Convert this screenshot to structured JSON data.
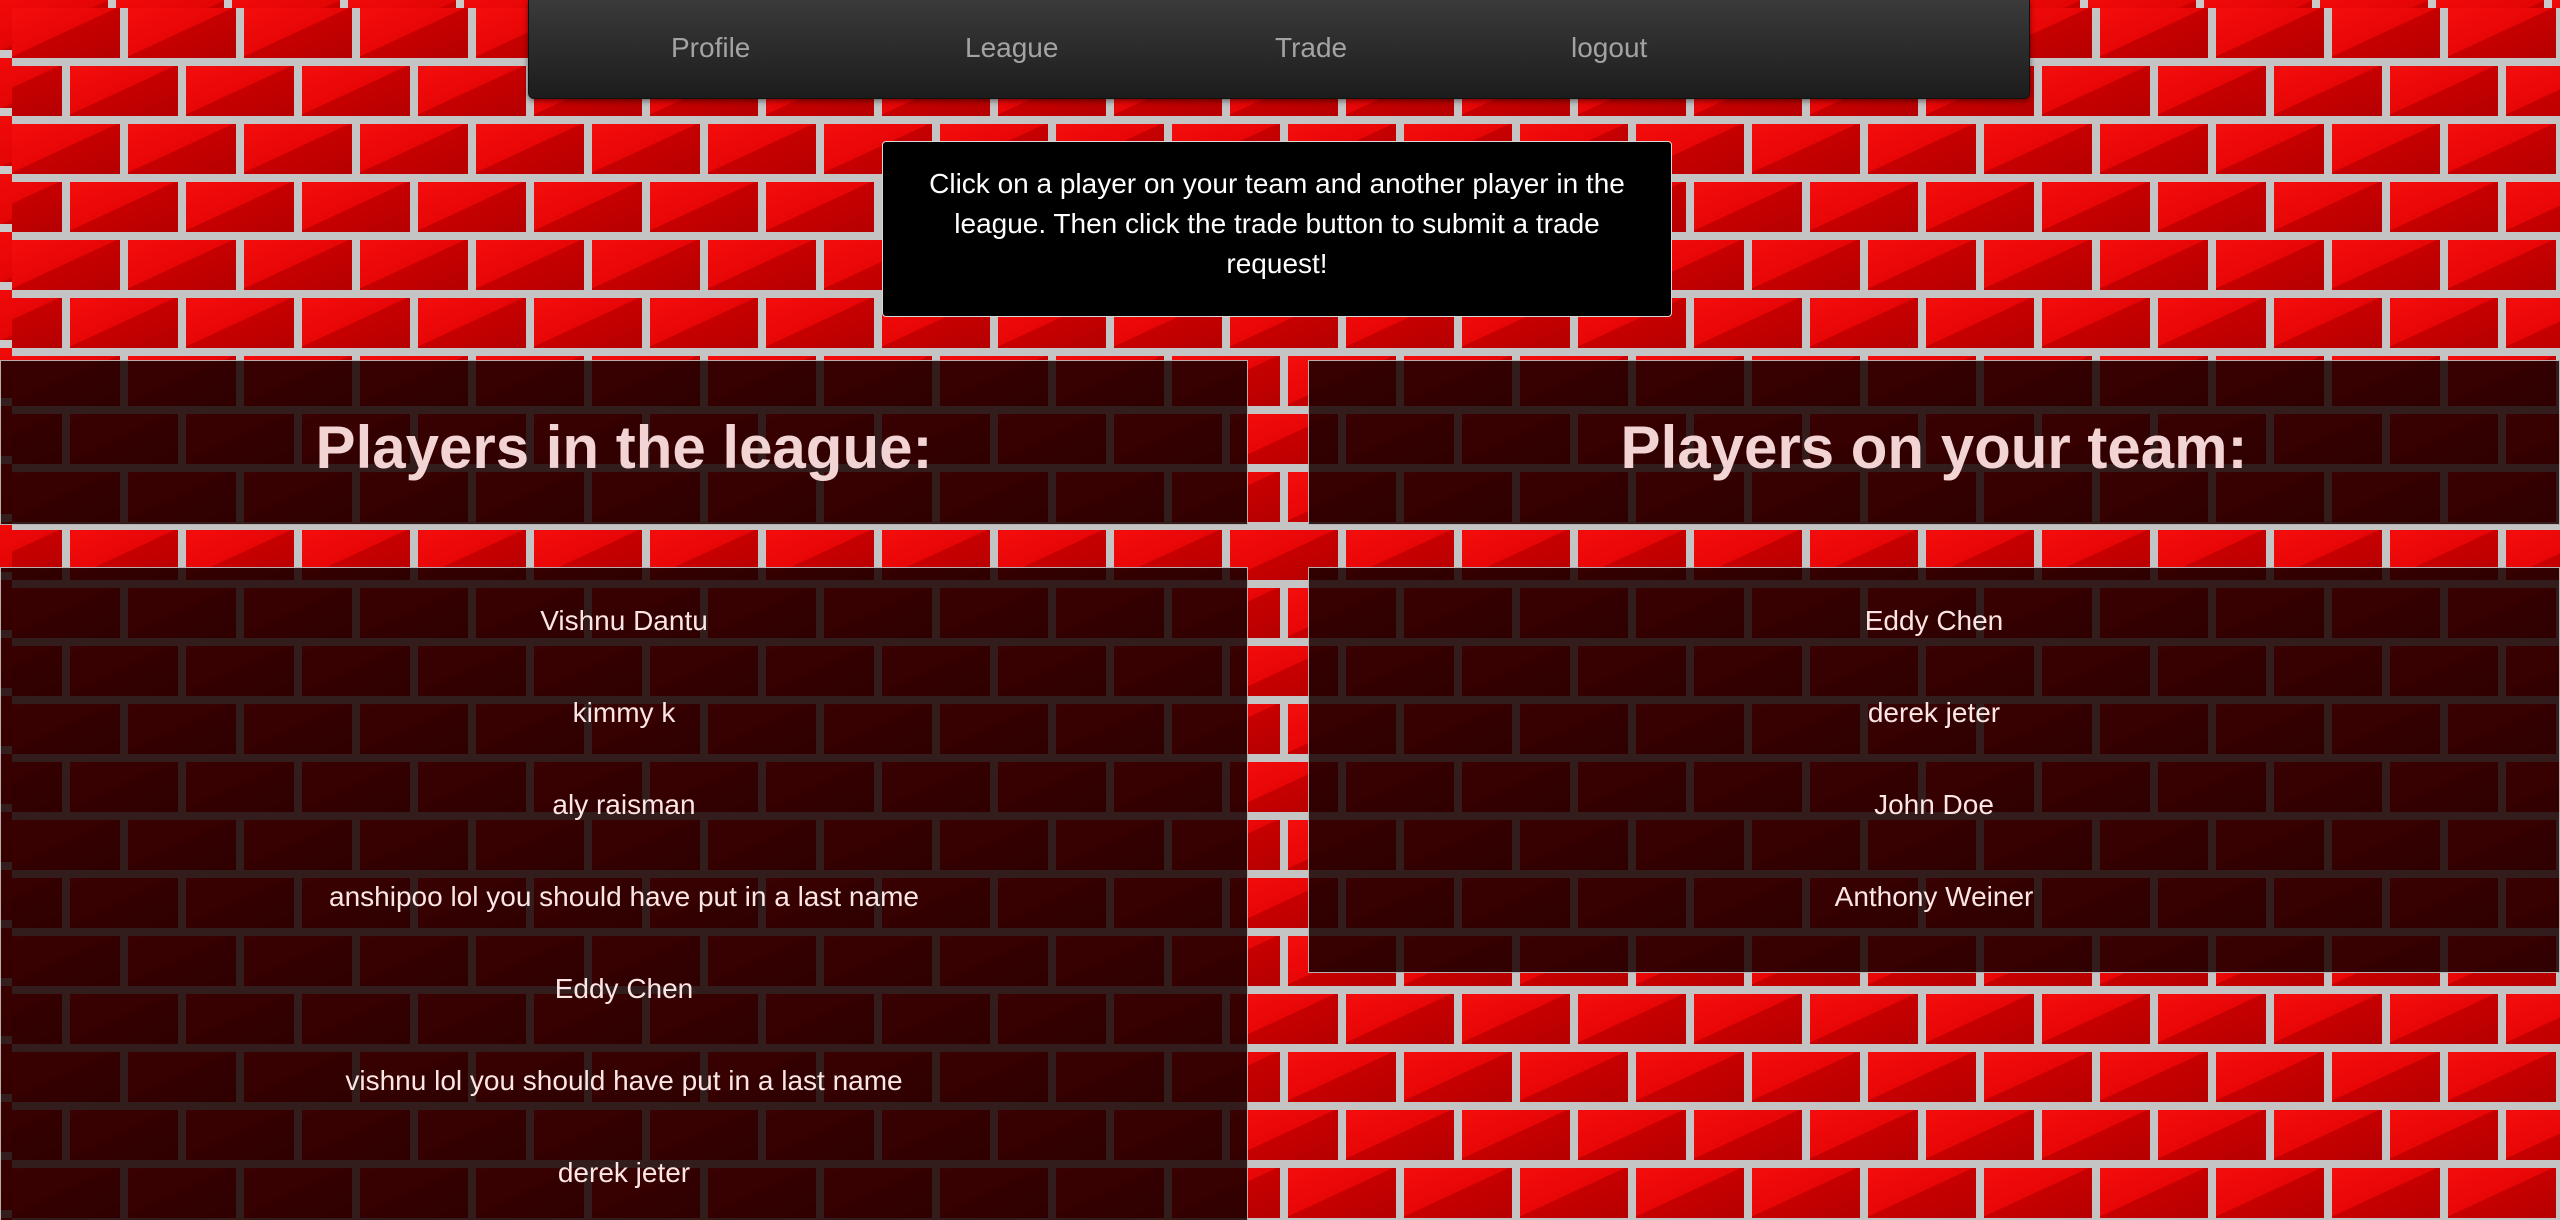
{
  "nav": {
    "profile": "Profile",
    "league": "League",
    "trade": "Trade",
    "logout": "logout"
  },
  "instructions": "Click on a player on your team and another player in the league. Then click the trade button to submit a trade request!",
  "league": {
    "title": "Players in the league:",
    "players": [
      "Vishnu Dantu",
      "kimmy k",
      "aly raisman",
      "anshipoo lol you should have put in a last name",
      "Eddy Chen",
      "vishnu lol you should have put in a last name",
      "derek jeter"
    ]
  },
  "team": {
    "title": "Players on your team:",
    "players": [
      "Eddy Chen",
      "derek jeter",
      "John Doe",
      "Anthony Weiner"
    ]
  },
  "colors": {
    "brick_red": "#e30505",
    "mortar": "#c9c9c9",
    "panel_bg": "#1a0000",
    "title_text": "#f3d4d4",
    "nav_text": "#a3a3a3"
  }
}
